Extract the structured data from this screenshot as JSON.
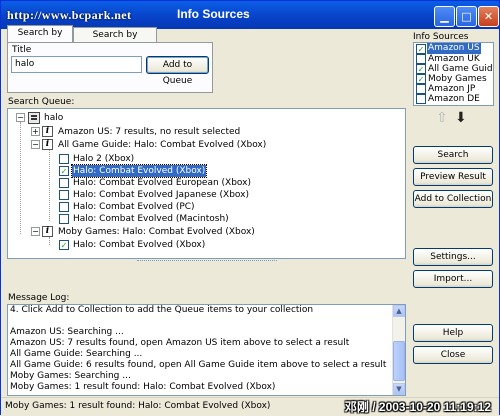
{
  "window": {
    "title": "Info Sources",
    "watermark": "http://www.bcpark.net"
  },
  "tabs": [
    {
      "label": "Search by Title"
    },
    {
      "label": "Search by Barcode"
    }
  ],
  "title_panel": {
    "title_label": "Title",
    "title_value": "halo",
    "add_button": "Add to Queue"
  },
  "info_sources": {
    "label": "Info Sources",
    "items": [
      {
        "label": "Amazon US",
        "checked": true,
        "selected": true
      },
      {
        "label": "Amazon UK",
        "checked": false
      },
      {
        "label": "All Game Guide",
        "checked": true
      },
      {
        "label": "Moby Games",
        "checked": true
      },
      {
        "label": "Amazon JP",
        "checked": false
      },
      {
        "label": "Amazon DE",
        "checked": false
      }
    ]
  },
  "search_queue": {
    "label": "Search Queue:",
    "root": "halo",
    "nodes": [
      {
        "text": "Amazon US: 7 results, no result selected",
        "expander": "+"
      },
      {
        "text": "All Game Guide: Halo: Combat Evolved (Xbox)",
        "expander": "−"
      },
      {
        "text": "Halo 2 (Xbox)",
        "checked": false
      },
      {
        "text": "Halo: Combat Evolved (Xbox)",
        "checked": true,
        "selected": true
      },
      {
        "text": "Halo: Combat Evolved European (Xbox)",
        "checked": false
      },
      {
        "text": "Halo: Combat Evolved Japanese (Xbox)",
        "checked": false
      },
      {
        "text": "Halo: Combat Evolved (PC)",
        "checked": false
      },
      {
        "text": "Halo: Combat Evolved (Macintosh)",
        "checked": false
      },
      {
        "text": "Moby Games: Halo: Combat Evolved (Xbox)",
        "expander": "−"
      },
      {
        "text": "Halo: Combat Evolved (Xbox)",
        "checked": true
      }
    ]
  },
  "buttons": {
    "search": "Search",
    "preview": "Preview Result",
    "add_collection": "Add to Collection",
    "settings": "Settings...",
    "import": "Import...",
    "help": "Help",
    "close": "Close"
  },
  "message_log": {
    "label": "Message Log:",
    "lines": [
      "4. Click Add to Collection to add the Queue items to your collection",
      "",
      "Amazon US: Searching ...",
      "Amazon US: 7 results found, open Amazon US item above to select a result",
      "All Game Guide: Searching ...",
      "All Game Guide: 6 results found, open All Game Guide item above to select a result",
      "Moby Games: Searching ...",
      "Moby Games: 1 result found: Halo: Combat Evolved (Xbox)"
    ]
  },
  "status": {
    "text": "Moby Games: 1 result found: Halo: Combat Evolved (Xbox)",
    "stamp": "邓刚 / 2003-10-20 11:19:12"
  }
}
